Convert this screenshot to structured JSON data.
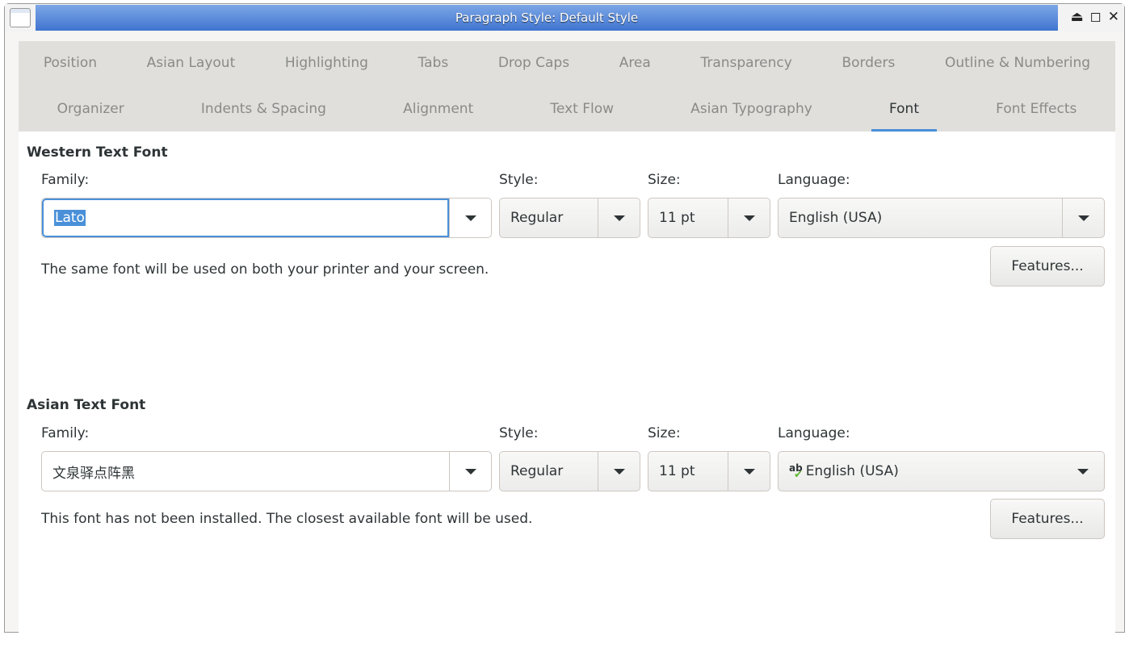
{
  "window": {
    "title": "Paragraph Style: Default Style"
  },
  "tabs_row1": [
    "Position",
    "Asian Layout",
    "Highlighting",
    "Tabs",
    "Drop Caps",
    "Area",
    "Transparency",
    "Borders",
    "Outline & Numbering"
  ],
  "tabs_row2": [
    "Organizer",
    "Indents & Spacing",
    "Alignment",
    "Text Flow",
    "Asian Typography",
    "Font",
    "Font Effects"
  ],
  "active_tab": "Font",
  "accent": "#4a90d9",
  "western": {
    "heading": "Western Text Font",
    "family_label": "Family:",
    "family": "Lato",
    "style_label": "Style:",
    "style": "Regular",
    "size_label": "Size:",
    "size": "11 pt",
    "language_label": "Language:",
    "language": "English (USA)",
    "features": "Features...",
    "note": "The same font will be used on both your printer and your screen."
  },
  "asian": {
    "heading": "Asian Text Font",
    "family_label": "Family:",
    "family": "文泉驿点阵黑",
    "style_label": "Style:",
    "style": "Regular",
    "size_label": "Size:",
    "size": "11 pt",
    "language_label": "Language:",
    "language": "English (USA)",
    "features": "Features...",
    "note": "This font has not been installed. The closest available font will be used."
  }
}
